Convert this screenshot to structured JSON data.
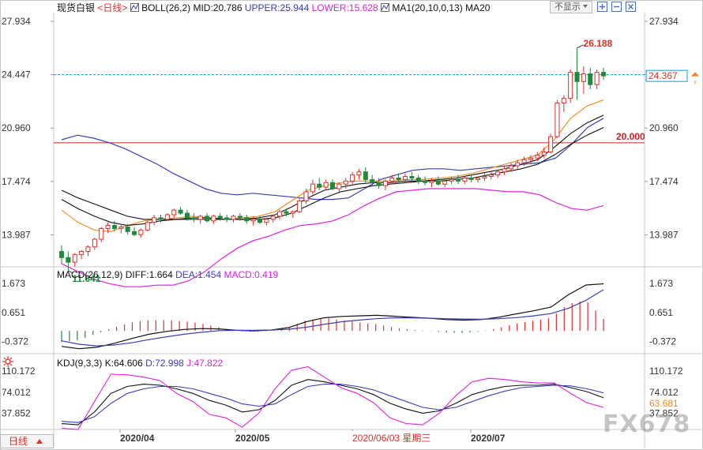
{
  "header": {
    "instrument": "现货白银",
    "period_tag": "<日线>",
    "boll": "BOLL(26,2)",
    "mid": "MID:20.786",
    "upper": "UPPER:25.944",
    "lower": "LOWER:15.628",
    "ma": "MA1(20,10,0,13)",
    "ma20": "MA20",
    "hide_button": "不显示",
    "plus_icon": "plus-square-icon",
    "minus_icon": "minus-square-icon",
    "close_icon": "close-icon"
  },
  "price_axis": {
    "ticks": [
      "27.934",
      "24.447",
      "20.960",
      "17.474",
      "13.987"
    ],
    "last_price": "24.367"
  },
  "annotations": {
    "high_label": "26.188",
    "low_label": "11.641",
    "level_label": "20.000"
  },
  "macd": {
    "label": "MACD(26,12,9)",
    "diff": "DIFF:1.664",
    "dea": "DEA:1.454",
    "macd": "MACD:0.419",
    "ticks": [
      "1.673",
      "0.651",
      "-0.372"
    ]
  },
  "kdj": {
    "label": "KDJ(9,3,3)",
    "k": "K:64.606",
    "d": "D:72.998",
    "j": "J:47.822",
    "ticks": [
      "110.172",
      "74.012",
      "37.852"
    ],
    "last": "63.681",
    "settings_icon": "gear-icon"
  },
  "time_axis": {
    "labels": [
      "2020/04",
      "2020/05",
      "2020/06/03 星期三",
      "2020/07"
    ],
    "period_button": "日线",
    "period_icon": "triangle-up-icon"
  },
  "watermark": "FX678",
  "colors": {
    "up": "#e0302a",
    "down": "#1f8a3a",
    "upper_band": "#3b3db8",
    "lower_band": "#e020e0",
    "ma_orange": "#f08a1c",
    "ma_black": "#111111",
    "level_line": "#cc2222",
    "current_line": "#00a0d8"
  },
  "chart_data": [
    {
      "type": "candlestick",
      "title": "现货白银",
      "y_ticks": [
        27.934,
        24.447,
        20.96,
        17.474,
        13.987
      ],
      "ylim": [
        12.0,
        28.5
      ],
      "candles": [
        {
          "o": 12.9,
          "h": 13.3,
          "l": 12.1,
          "c": 12.5
        },
        {
          "o": 12.5,
          "h": 12.9,
          "l": 11.641,
          "c": 12.2
        },
        {
          "o": 12.2,
          "h": 12.8,
          "l": 11.9,
          "c": 12.7
        },
        {
          "o": 12.7,
          "h": 13.0,
          "l": 12.4,
          "c": 12.9
        },
        {
          "o": 12.9,
          "h": 13.3,
          "l": 12.6,
          "c": 13.2
        },
        {
          "o": 13.2,
          "h": 13.8,
          "l": 13.0,
          "c": 13.7
        },
        {
          "o": 13.7,
          "h": 14.5,
          "l": 13.5,
          "c": 14.4
        },
        {
          "o": 14.4,
          "h": 14.8,
          "l": 14.1,
          "c": 14.6
        },
        {
          "o": 14.6,
          "h": 14.9,
          "l": 14.2,
          "c": 14.4
        },
        {
          "o": 14.4,
          "h": 14.7,
          "l": 14.1,
          "c": 14.5
        },
        {
          "o": 14.5,
          "h": 14.7,
          "l": 14.0,
          "c": 14.2
        },
        {
          "o": 14.2,
          "h": 14.5,
          "l": 13.9,
          "c": 14.0
        },
        {
          "o": 14.0,
          "h": 14.4,
          "l": 13.8,
          "c": 14.3
        },
        {
          "o": 14.3,
          "h": 14.9,
          "l": 14.2,
          "c": 14.8
        },
        {
          "o": 14.8,
          "h": 15.3,
          "l": 14.6,
          "c": 15.1
        },
        {
          "o": 15.1,
          "h": 15.3,
          "l": 14.8,
          "c": 15.0
        },
        {
          "o": 15.0,
          "h": 15.4,
          "l": 14.9,
          "c": 15.3
        },
        {
          "o": 15.3,
          "h": 15.7,
          "l": 15.1,
          "c": 15.6
        },
        {
          "o": 15.6,
          "h": 15.8,
          "l": 15.3,
          "c": 15.4
        },
        {
          "o": 15.4,
          "h": 15.6,
          "l": 14.9,
          "c": 15.1
        },
        {
          "o": 15.1,
          "h": 15.4,
          "l": 14.8,
          "c": 15.0
        },
        {
          "o": 15.0,
          "h": 15.3,
          "l": 14.7,
          "c": 15.2
        },
        {
          "o": 15.2,
          "h": 15.4,
          "l": 14.8,
          "c": 14.9
        },
        {
          "o": 14.9,
          "h": 15.3,
          "l": 14.7,
          "c": 15.2
        },
        {
          "o": 15.2,
          "h": 15.4,
          "l": 14.9,
          "c": 15.1
        },
        {
          "o": 15.1,
          "h": 15.3,
          "l": 14.8,
          "c": 15.0
        },
        {
          "o": 15.0,
          "h": 15.3,
          "l": 14.8,
          "c": 15.2
        },
        {
          "o": 15.2,
          "h": 15.4,
          "l": 14.9,
          "c": 15.1
        },
        {
          "o": 15.1,
          "h": 15.3,
          "l": 14.7,
          "c": 14.9
        },
        {
          "o": 14.9,
          "h": 15.2,
          "l": 14.6,
          "c": 15.0
        },
        {
          "o": 15.0,
          "h": 15.2,
          "l": 14.7,
          "c": 14.8
        },
        {
          "o": 14.8,
          "h": 15.1,
          "l": 14.6,
          "c": 15.0
        },
        {
          "o": 15.0,
          "h": 15.3,
          "l": 14.8,
          "c": 15.2
        },
        {
          "o": 15.2,
          "h": 15.6,
          "l": 15.0,
          "c": 15.5
        },
        {
          "o": 15.5,
          "h": 15.7,
          "l": 15.2,
          "c": 15.4
        },
        {
          "o": 15.4,
          "h": 15.6,
          "l": 15.1,
          "c": 15.5
        },
        {
          "o": 15.5,
          "h": 16.4,
          "l": 15.4,
          "c": 16.2
        },
        {
          "o": 16.2,
          "h": 17.0,
          "l": 16.0,
          "c": 16.8
        },
        {
          "o": 16.8,
          "h": 17.6,
          "l": 16.6,
          "c": 17.3
        },
        {
          "o": 17.3,
          "h": 17.7,
          "l": 16.9,
          "c": 17.1
        },
        {
          "o": 17.1,
          "h": 17.6,
          "l": 16.9,
          "c": 17.4
        },
        {
          "o": 17.4,
          "h": 17.6,
          "l": 16.9,
          "c": 17.0
        },
        {
          "o": 17.0,
          "h": 17.4,
          "l": 16.7,
          "c": 17.3
        },
        {
          "o": 17.3,
          "h": 17.7,
          "l": 17.0,
          "c": 17.5
        },
        {
          "o": 17.5,
          "h": 18.1,
          "l": 17.3,
          "c": 17.9
        },
        {
          "o": 17.9,
          "h": 18.3,
          "l": 17.6,
          "c": 18.1
        },
        {
          "o": 18.1,
          "h": 18.4,
          "l": 17.4,
          "c": 17.6
        },
        {
          "o": 17.6,
          "h": 17.9,
          "l": 17.2,
          "c": 17.4
        },
        {
          "o": 17.4,
          "h": 17.7,
          "l": 17.0,
          "c": 17.2
        },
        {
          "o": 17.2,
          "h": 17.6,
          "l": 16.9,
          "c": 17.5
        },
        {
          "o": 17.5,
          "h": 17.9,
          "l": 17.3,
          "c": 17.7
        },
        {
          "o": 17.7,
          "h": 18.0,
          "l": 17.4,
          "c": 17.6
        },
        {
          "o": 17.6,
          "h": 18.0,
          "l": 17.4,
          "c": 17.8
        },
        {
          "o": 17.8,
          "h": 18.1,
          "l": 17.5,
          "c": 17.7
        },
        {
          "o": 17.7,
          "h": 17.9,
          "l": 17.3,
          "c": 17.5
        },
        {
          "o": 17.5,
          "h": 17.8,
          "l": 17.2,
          "c": 17.4
        },
        {
          "o": 17.4,
          "h": 17.7,
          "l": 17.1,
          "c": 17.5
        },
        {
          "o": 17.5,
          "h": 17.8,
          "l": 17.2,
          "c": 17.3
        },
        {
          "o": 17.3,
          "h": 17.6,
          "l": 17.1,
          "c": 17.5
        },
        {
          "o": 17.5,
          "h": 17.8,
          "l": 17.3,
          "c": 17.6
        },
        {
          "o": 17.6,
          "h": 17.9,
          "l": 17.3,
          "c": 17.5
        },
        {
          "o": 17.5,
          "h": 17.8,
          "l": 17.3,
          "c": 17.7
        },
        {
          "o": 17.7,
          "h": 17.9,
          "l": 17.4,
          "c": 17.6
        },
        {
          "o": 17.6,
          "h": 17.8,
          "l": 17.4,
          "c": 17.7
        },
        {
          "o": 17.7,
          "h": 18.0,
          "l": 17.5,
          "c": 17.8
        },
        {
          "o": 17.8,
          "h": 18.1,
          "l": 17.6,
          "c": 17.9
        },
        {
          "o": 17.9,
          "h": 18.2,
          "l": 17.7,
          "c": 18.1
        },
        {
          "o": 18.1,
          "h": 18.5,
          "l": 17.9,
          "c": 18.3
        },
        {
          "o": 18.3,
          "h": 18.7,
          "l": 18.1,
          "c": 18.5
        },
        {
          "o": 18.5,
          "h": 18.9,
          "l": 18.3,
          "c": 18.7
        },
        {
          "o": 18.7,
          "h": 19.1,
          "l": 18.5,
          "c": 18.9
        },
        {
          "o": 18.9,
          "h": 19.2,
          "l": 18.6,
          "c": 19.0
        },
        {
          "o": 19.0,
          "h": 19.4,
          "l": 18.8,
          "c": 19.2
        },
        {
          "o": 19.2,
          "h": 19.7,
          "l": 19.0,
          "c": 19.4
        },
        {
          "o": 19.4,
          "h": 20.6,
          "l": 19.3,
          "c": 20.4
        },
        {
          "o": 20.4,
          "h": 22.8,
          "l": 20.3,
          "c": 22.6
        },
        {
          "o": 22.6,
          "h": 23.1,
          "l": 22.0,
          "c": 22.9
        },
        {
          "o": 22.9,
          "h": 24.8,
          "l": 22.6,
          "c": 24.6
        },
        {
          "o": 24.6,
          "h": 26.188,
          "l": 22.8,
          "c": 24.0
        },
        {
          "o": 24.0,
          "h": 25.0,
          "l": 23.2,
          "c": 24.5
        },
        {
          "o": 24.5,
          "h": 24.9,
          "l": 23.5,
          "c": 23.8
        },
        {
          "o": 23.8,
          "h": 24.8,
          "l": 23.5,
          "c": 24.6
        },
        {
          "o": 24.6,
          "h": 24.9,
          "l": 24.1,
          "c": 24.367
        }
      ],
      "boll_upper": [
        20.2,
        20.5,
        20.3,
        20.0,
        19.6,
        19.1,
        18.6,
        18.0,
        17.5,
        17.0,
        16.7,
        16.6,
        16.7,
        16.6,
        16.5,
        16.4,
        16.3,
        16.3,
        16.4,
        17.0,
        17.6,
        17.9,
        18.2,
        18.3,
        18.3,
        18.2,
        18.3,
        18.4,
        18.5,
        18.6,
        18.7,
        19.0,
        19.9,
        21.0,
        21.6
      ],
      "boll_mid": [
        16.0,
        15.7,
        15.3,
        14.8,
        14.5,
        14.3,
        14.3,
        14.5,
        14.7,
        14.9,
        15.0,
        15.0,
        15.1,
        15.1,
        15.1,
        15.0,
        15.2,
        15.5,
        16.1,
        16.6,
        17.0,
        17.3,
        17.5,
        17.6,
        17.6,
        17.6,
        17.7,
        17.7,
        17.8,
        17.9,
        18.1,
        18.6,
        19.6,
        20.4,
        20.8
      ],
      "boll_lower": [
        12.1,
        11.6,
        11.1,
        10.8,
        10.6,
        10.6,
        10.7,
        10.7,
        11.0,
        11.6,
        12.4,
        13.1,
        13.6,
        13.9,
        14.3,
        14.6,
        14.7,
        14.9,
        15.3,
        15.9,
        16.4,
        16.8,
        16.9,
        17.0,
        17.0,
        17.0,
        17.0,
        16.9,
        16.8,
        16.8,
        16.6,
        16.1,
        15.7,
        15.6,
        15.9
      ],
      "ma_lines": [
        {
          "color": "#f08a1c",
          "values": [
            15.6,
            14.8,
            14.3,
            14.2,
            14.6,
            14.9,
            15.0,
            15.1,
            15.2,
            15.1,
            15.0,
            15.1,
            15.2,
            15.5,
            16.2,
            16.9,
            17.2,
            17.4,
            17.5,
            17.5,
            17.5,
            17.6,
            17.6,
            17.7,
            17.8,
            18.0,
            18.3,
            18.6,
            18.9,
            19.2,
            20.2,
            21.6,
            22.4,
            22.8
          ]
        },
        {
          "color": "#111111",
          "values": [
            16.3,
            15.7,
            15.2,
            14.8,
            14.6,
            14.7,
            14.9,
            15.0,
            15.1,
            15.1,
            15.0,
            15.0,
            15.1,
            15.3,
            15.8,
            16.4,
            16.9,
            17.1,
            17.3,
            17.4,
            17.4,
            17.5,
            17.5,
            17.6,
            17.7,
            17.9,
            18.1,
            18.3,
            18.6,
            18.9,
            19.7,
            20.6,
            21.3,
            21.8
          ]
        },
        {
          "color": "#111111",
          "values": [
            16.9,
            16.4,
            16.0,
            15.6,
            15.2,
            15.0,
            15.0,
            15.0,
            15.0,
            15.0,
            15.0,
            15.0,
            15.0,
            15.1,
            15.4,
            15.9,
            16.4,
            16.8,
            17.0,
            17.2,
            17.3,
            17.4,
            17.5,
            17.5,
            17.6,
            17.7,
            17.9,
            18.1,
            18.3,
            18.6,
            19.2,
            19.9,
            20.5,
            21.0
          ]
        }
      ],
      "horizontal_lines": [
        20.0,
        24.447
      ]
    },
    {
      "type": "line",
      "title": "MACD(26,12,9)",
      "y_ticks": [
        1.673,
        0.651,
        -0.372
      ],
      "ylim": [
        -0.75,
        1.9
      ],
      "series": [
        {
          "name": "DIFF",
          "values": [
            -0.55,
            -0.63,
            -0.58,
            -0.44,
            -0.27,
            -0.12,
            -0.02,
            0.05,
            0.08,
            0.07,
            0.02,
            0.0,
            0.03,
            0.12,
            0.32,
            0.46,
            0.51,
            0.53,
            0.55,
            0.52,
            0.48,
            0.45,
            0.4,
            0.38,
            0.4,
            0.48,
            0.6,
            0.71,
            0.84,
            1.28,
            1.62,
            1.664
          ]
        },
        {
          "name": "DEA",
          "values": [
            -0.35,
            -0.47,
            -0.53,
            -0.5,
            -0.42,
            -0.31,
            -0.21,
            -0.12,
            -0.05,
            0.01,
            0.02,
            0.02,
            0.03,
            0.06,
            0.13,
            0.23,
            0.32,
            0.38,
            0.43,
            0.46,
            0.46,
            0.45,
            0.43,
            0.42,
            0.41,
            0.43,
            0.47,
            0.53,
            0.61,
            0.8,
            1.08,
            1.454
          ]
        },
        {
          "name": "MACD",
          "values": [
            -0.4,
            -0.32,
            -0.1,
            0.12,
            0.3,
            0.38,
            0.38,
            0.34,
            0.26,
            0.12,
            0.0,
            -0.04,
            0.0,
            0.12,
            0.38,
            0.46,
            0.38,
            0.3,
            0.24,
            0.12,
            0.04,
            0.0,
            -0.06,
            -0.08,
            -0.02,
            0.1,
            0.26,
            0.36,
            0.46,
            0.96,
            1.08,
            0.419
          ]
        }
      ]
    },
    {
      "type": "line",
      "title": "KDJ(9,3,3)",
      "y_ticks": [
        110.172,
        74.012,
        37.852
      ],
      "ylim": [
        10,
        120
      ],
      "series": [
        {
          "name": "K",
          "values": [
            20,
            18,
            40,
            72,
            84,
            88,
            86,
            80,
            72,
            60,
            52,
            40,
            44,
            60,
            86,
            96,
            92,
            86,
            80,
            70,
            55,
            45,
            38,
            42,
            55,
            70,
            78,
            84,
            86,
            86,
            88,
            82,
            75,
            64.606
          ]
        },
        {
          "name": "D",
          "values": [
            24,
            22,
            32,
            55,
            72,
            80,
            84,
            84,
            80,
            72,
            64,
            54,
            50,
            54,
            70,
            84,
            88,
            88,
            84,
            78,
            68,
            58,
            48,
            44,
            48,
            58,
            68,
            76,
            82,
            84,
            86,
            85,
            80,
            72.998
          ]
        },
        {
          "name": "J",
          "values": [
            12,
            10,
            58,
            105,
            104,
            100,
            94,
            72,
            58,
            36,
            30,
            14,
            38,
            80,
            112,
            118,
            100,
            82,
            72,
            56,
            30,
            20,
            18,
            38,
            68,
            92,
            98,
            96,
            92,
            90,
            90,
            72,
            56,
            47.822
          ]
        }
      ]
    }
  ]
}
